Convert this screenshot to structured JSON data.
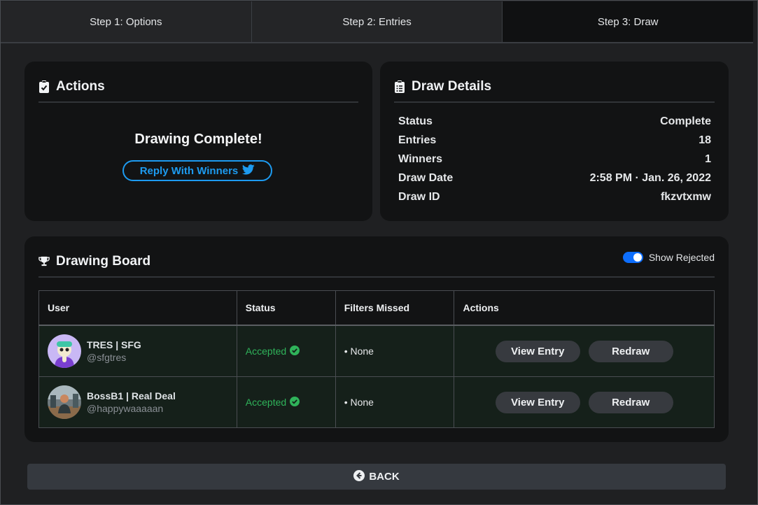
{
  "tabs": [
    {
      "label": "Step 1: Options"
    },
    {
      "label": "Step 2: Entries"
    },
    {
      "label": "Step 3: Draw"
    }
  ],
  "actions_card": {
    "title": "Actions",
    "complete_text": "Drawing Complete!",
    "reply_button": "Reply With Winners"
  },
  "details_card": {
    "title": "Draw Details",
    "rows": [
      {
        "label": "Status",
        "value": "Complete"
      },
      {
        "label": "Entries",
        "value": "18"
      },
      {
        "label": "Winners",
        "value": "1"
      },
      {
        "label": "Draw Date",
        "value": "2:58 PM · Jan. 26, 2022"
      },
      {
        "label": "Draw ID",
        "value": "fkzvtxmw"
      }
    ]
  },
  "board": {
    "title": "Drawing Board",
    "toggle_label": "Show Rejected",
    "toggle_on": true,
    "columns": [
      "User",
      "Status",
      "Filters Missed",
      "Actions"
    ],
    "rows": [
      {
        "name": "TRES | SFG",
        "handle": "@sfgtres",
        "status": "Accepted",
        "filters": "• None",
        "view": "View Entry",
        "redraw": "Redraw"
      },
      {
        "name": "BossB1 | Real Deal",
        "handle": "@happywaaaaan",
        "status": "Accepted",
        "filters": "• None",
        "view": "View Entry",
        "redraw": "Redraw"
      }
    ]
  },
  "back_button": "BACK",
  "colors": {
    "accent": "#1d9bf0",
    "accepted": "#2fb35a",
    "toggle": "#0d6efd"
  }
}
